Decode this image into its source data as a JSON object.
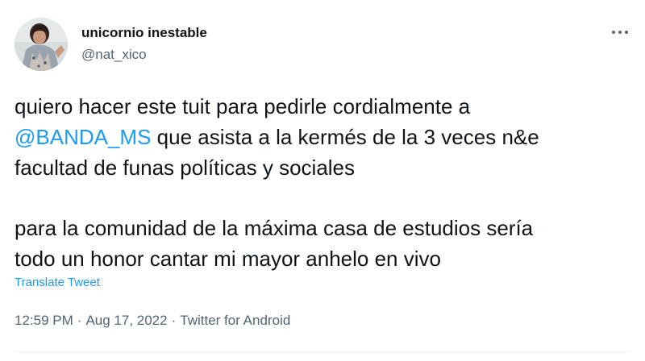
{
  "author": {
    "display_name": "unicornio inestable",
    "handle": "@nat_xico"
  },
  "tweet": {
    "line1": "quiero hacer este tuit para pedirle cordialmente a",
    "mention": "@BANDA_MS",
    "line2_rest": " que asista a la kermés de la 3 veces n&e",
    "line3": "facultad de funas políticas y sociales",
    "line4": "para la comunidad de la máxima casa de estudios sería",
    "line5": "todo un honor cantar mi mayor anhelo en vivo",
    "translate_label": "Translate Tweet"
  },
  "meta": {
    "time": "12:59 PM",
    "date": "Aug 17, 2022",
    "separator": "·",
    "source": "Twitter for Android"
  },
  "icons": {
    "more": "more-horizontal-icon",
    "avatar": "profile-photo"
  },
  "colors": {
    "text": "#0f1419",
    "secondary": "#536471",
    "link": "#1d9bf0"
  }
}
